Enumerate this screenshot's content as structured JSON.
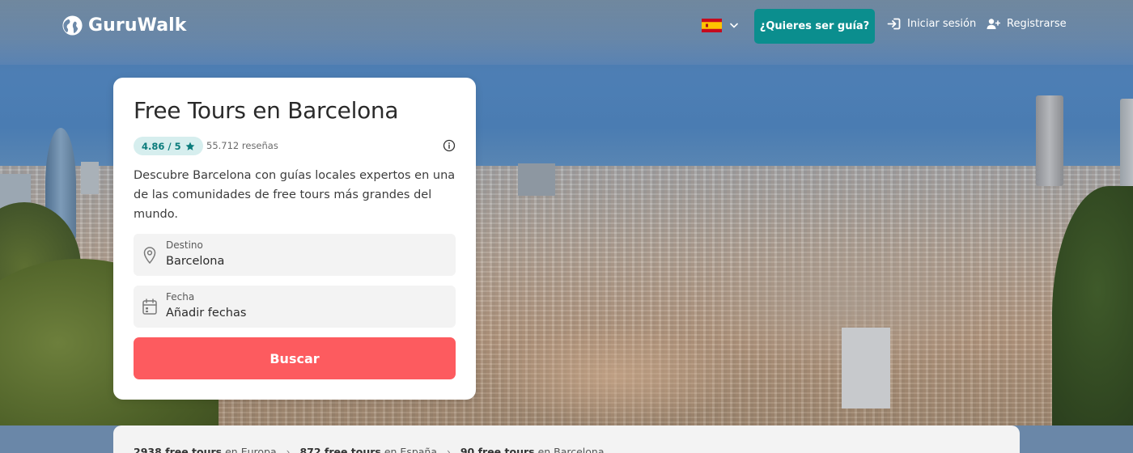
{
  "header": {
    "brand": "GuruWalk",
    "language_flag": "es-flag",
    "guide_button": "¿Quieres ser guía?",
    "login_label": "Iniciar sesión",
    "register_label": "Registrarse"
  },
  "card": {
    "title": "Free Tours en Barcelona",
    "rating": "4.86 / 5",
    "reviews": "55.712 reseñas",
    "description": "Descubre Barcelona con guías locales expertos en una de las comunidades de free tours más grandes del mundo.",
    "destination": {
      "label": "Destino",
      "value": "Barcelona"
    },
    "date": {
      "label": "Fecha",
      "value": "Añadir fechas"
    },
    "search_button": "Buscar"
  },
  "breadcrumb": [
    {
      "count": "2938 free tours",
      "place": "en Europa"
    },
    {
      "count": "872 free tours",
      "place": "en España"
    },
    {
      "count": "90 free tours",
      "place": "en Barcelona"
    }
  ],
  "colors": {
    "primary_teal": "#0b8e8e",
    "search_red": "#fd5b5f",
    "rating_bg": "#d6eeee"
  },
  "icons": [
    "globe-icon",
    "chevron-down-icon",
    "login-icon",
    "user-plus-icon",
    "star-icon",
    "info-icon",
    "location-pin-icon",
    "calendar-icon",
    "chevron-right-icon"
  ]
}
